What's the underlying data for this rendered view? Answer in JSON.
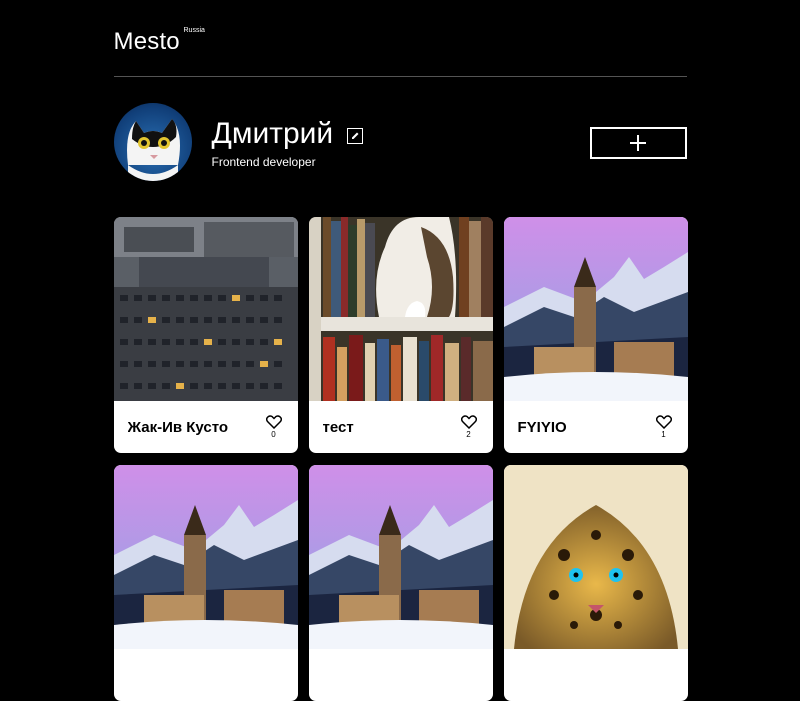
{
  "header": {
    "logo": "Mesto",
    "logo_sub": "Russia"
  },
  "profile": {
    "name": "Дмитрий",
    "about": "Frontend developer"
  },
  "icons": {
    "edit": "pencil-icon",
    "add": "plus-icon",
    "like": "heart-icon"
  },
  "cards": [
    {
      "title": "Жак-Ив Кусто",
      "likes": "0",
      "image": "apartment-building-photo"
    },
    {
      "title": "тест",
      "likes": "2",
      "image": "cat-on-bookshelf-photo"
    },
    {
      "title": "FYIYIO",
      "likes": "1",
      "image": "snowy-village-photo"
    },
    {
      "title": "",
      "likes": "",
      "image": "snowy-village-photo"
    },
    {
      "title": "",
      "likes": "",
      "image": "snowy-village-photo"
    },
    {
      "title": "",
      "likes": "",
      "image": "leopard-art-photo"
    }
  ]
}
